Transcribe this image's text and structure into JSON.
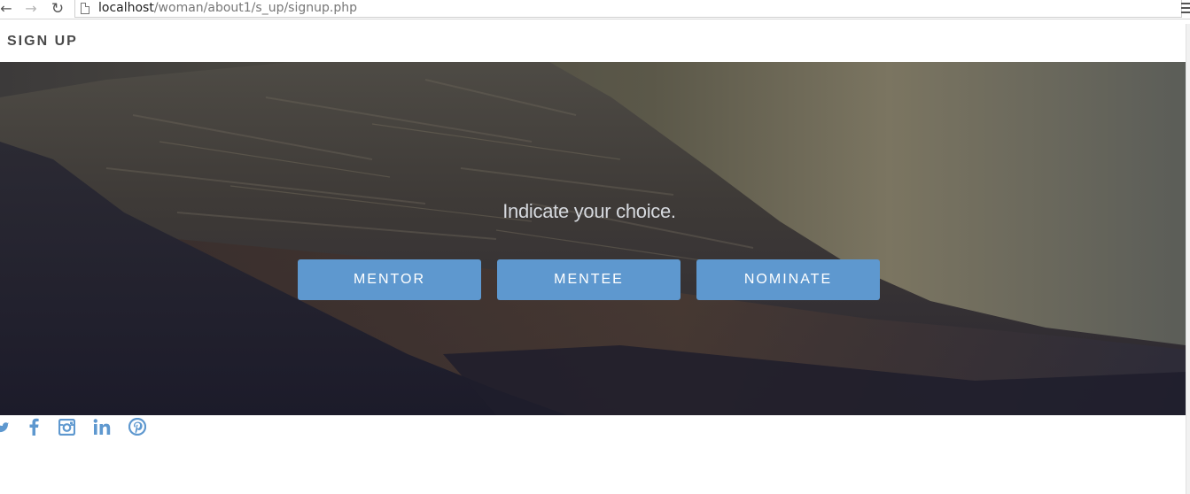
{
  "browser": {
    "url_host": "localhost",
    "url_path": "/woman/about1/s_up/signup.php",
    "icons": [
      "back-icon",
      "forward-icon",
      "reload-icon",
      "page-icon",
      "zoom-icon",
      "star-icon",
      "menu-icon"
    ],
    "back_glyph": "←",
    "forward_glyph": "→",
    "reload_glyph": "↻",
    "star_glyph": "☆"
  },
  "header": {
    "title": "SIGN UP"
  },
  "hero": {
    "prompt": "Indicate your choice.",
    "buttons": [
      {
        "label": "MENTOR"
      },
      {
        "label": "MENTEE"
      },
      {
        "label": "NOMINATE"
      }
    ]
  },
  "social": {
    "icons": [
      "twitter-icon",
      "facebook-icon",
      "instagram-icon",
      "linkedin-icon",
      "pinterest-icon"
    ]
  },
  "colors": {
    "accent": "#5e98cf",
    "title_text": "#4a4a4a",
    "hero_text": "#d5d8dd"
  }
}
